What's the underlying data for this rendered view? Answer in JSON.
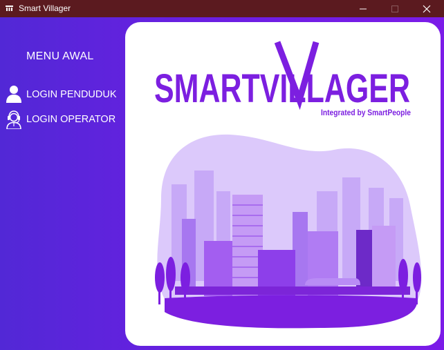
{
  "window": {
    "title": "Smart Villager",
    "icon": "app-logo-icon",
    "controls": [
      "minimize-icon",
      "maximize-icon",
      "close-icon"
    ]
  },
  "sidebar": {
    "heading": "MENU AWAL",
    "items": [
      {
        "label": "LOGIN PENDUDUK",
        "icon": "user-icon"
      },
      {
        "label": "LOGIN OPERATOR",
        "icon": "operator-headset-icon"
      }
    ]
  },
  "logo": {
    "title": "SMARTVILLAGER",
    "tagline": "Integrated by SmartPeople"
  },
  "colors": {
    "titlebar": "#5b1a1f",
    "sidebar_start": "#5228d6",
    "sidebar_end": "#7b1be8",
    "brand_purple": "#7c1fe0",
    "card": "#ffffff"
  }
}
